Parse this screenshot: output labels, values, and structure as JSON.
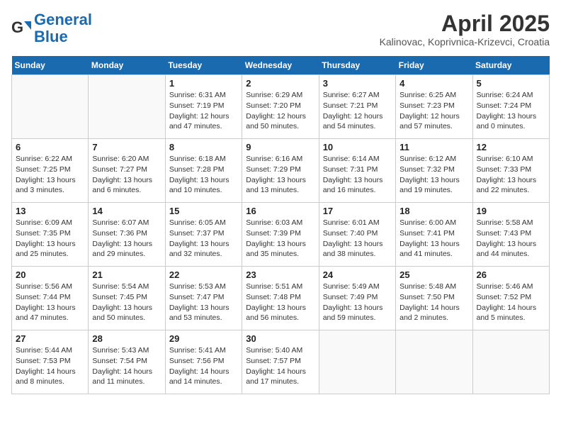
{
  "header": {
    "logo_line1": "General",
    "logo_line2": "Blue",
    "month_year": "April 2025",
    "location": "Kalinovac, Koprivnica-Krizevci, Croatia"
  },
  "days_of_week": [
    "Sunday",
    "Monday",
    "Tuesday",
    "Wednesday",
    "Thursday",
    "Friday",
    "Saturday"
  ],
  "weeks": [
    [
      {
        "day": "",
        "info": ""
      },
      {
        "day": "",
        "info": ""
      },
      {
        "day": "1",
        "info": "Sunrise: 6:31 AM\nSunset: 7:19 PM\nDaylight: 12 hours\nand 47 minutes."
      },
      {
        "day": "2",
        "info": "Sunrise: 6:29 AM\nSunset: 7:20 PM\nDaylight: 12 hours\nand 50 minutes."
      },
      {
        "day": "3",
        "info": "Sunrise: 6:27 AM\nSunset: 7:21 PM\nDaylight: 12 hours\nand 54 minutes."
      },
      {
        "day": "4",
        "info": "Sunrise: 6:25 AM\nSunset: 7:23 PM\nDaylight: 12 hours\nand 57 minutes."
      },
      {
        "day": "5",
        "info": "Sunrise: 6:24 AM\nSunset: 7:24 PM\nDaylight: 13 hours\nand 0 minutes."
      }
    ],
    [
      {
        "day": "6",
        "info": "Sunrise: 6:22 AM\nSunset: 7:25 PM\nDaylight: 13 hours\nand 3 minutes."
      },
      {
        "day": "7",
        "info": "Sunrise: 6:20 AM\nSunset: 7:27 PM\nDaylight: 13 hours\nand 6 minutes."
      },
      {
        "day": "8",
        "info": "Sunrise: 6:18 AM\nSunset: 7:28 PM\nDaylight: 13 hours\nand 10 minutes."
      },
      {
        "day": "9",
        "info": "Sunrise: 6:16 AM\nSunset: 7:29 PM\nDaylight: 13 hours\nand 13 minutes."
      },
      {
        "day": "10",
        "info": "Sunrise: 6:14 AM\nSunset: 7:31 PM\nDaylight: 13 hours\nand 16 minutes."
      },
      {
        "day": "11",
        "info": "Sunrise: 6:12 AM\nSunset: 7:32 PM\nDaylight: 13 hours\nand 19 minutes."
      },
      {
        "day": "12",
        "info": "Sunrise: 6:10 AM\nSunset: 7:33 PM\nDaylight: 13 hours\nand 22 minutes."
      }
    ],
    [
      {
        "day": "13",
        "info": "Sunrise: 6:09 AM\nSunset: 7:35 PM\nDaylight: 13 hours\nand 25 minutes."
      },
      {
        "day": "14",
        "info": "Sunrise: 6:07 AM\nSunset: 7:36 PM\nDaylight: 13 hours\nand 29 minutes."
      },
      {
        "day": "15",
        "info": "Sunrise: 6:05 AM\nSunset: 7:37 PM\nDaylight: 13 hours\nand 32 minutes."
      },
      {
        "day": "16",
        "info": "Sunrise: 6:03 AM\nSunset: 7:39 PM\nDaylight: 13 hours\nand 35 minutes."
      },
      {
        "day": "17",
        "info": "Sunrise: 6:01 AM\nSunset: 7:40 PM\nDaylight: 13 hours\nand 38 minutes."
      },
      {
        "day": "18",
        "info": "Sunrise: 6:00 AM\nSunset: 7:41 PM\nDaylight: 13 hours\nand 41 minutes."
      },
      {
        "day": "19",
        "info": "Sunrise: 5:58 AM\nSunset: 7:43 PM\nDaylight: 13 hours\nand 44 minutes."
      }
    ],
    [
      {
        "day": "20",
        "info": "Sunrise: 5:56 AM\nSunset: 7:44 PM\nDaylight: 13 hours\nand 47 minutes."
      },
      {
        "day": "21",
        "info": "Sunrise: 5:54 AM\nSunset: 7:45 PM\nDaylight: 13 hours\nand 50 minutes."
      },
      {
        "day": "22",
        "info": "Sunrise: 5:53 AM\nSunset: 7:47 PM\nDaylight: 13 hours\nand 53 minutes."
      },
      {
        "day": "23",
        "info": "Sunrise: 5:51 AM\nSunset: 7:48 PM\nDaylight: 13 hours\nand 56 minutes."
      },
      {
        "day": "24",
        "info": "Sunrise: 5:49 AM\nSunset: 7:49 PM\nDaylight: 13 hours\nand 59 minutes."
      },
      {
        "day": "25",
        "info": "Sunrise: 5:48 AM\nSunset: 7:50 PM\nDaylight: 14 hours\nand 2 minutes."
      },
      {
        "day": "26",
        "info": "Sunrise: 5:46 AM\nSunset: 7:52 PM\nDaylight: 14 hours\nand 5 minutes."
      }
    ],
    [
      {
        "day": "27",
        "info": "Sunrise: 5:44 AM\nSunset: 7:53 PM\nDaylight: 14 hours\nand 8 minutes."
      },
      {
        "day": "28",
        "info": "Sunrise: 5:43 AM\nSunset: 7:54 PM\nDaylight: 14 hours\nand 11 minutes."
      },
      {
        "day": "29",
        "info": "Sunrise: 5:41 AM\nSunset: 7:56 PM\nDaylight: 14 hours\nand 14 minutes."
      },
      {
        "day": "30",
        "info": "Sunrise: 5:40 AM\nSunset: 7:57 PM\nDaylight: 14 hours\nand 17 minutes."
      },
      {
        "day": "",
        "info": ""
      },
      {
        "day": "",
        "info": ""
      },
      {
        "day": "",
        "info": ""
      }
    ]
  ]
}
